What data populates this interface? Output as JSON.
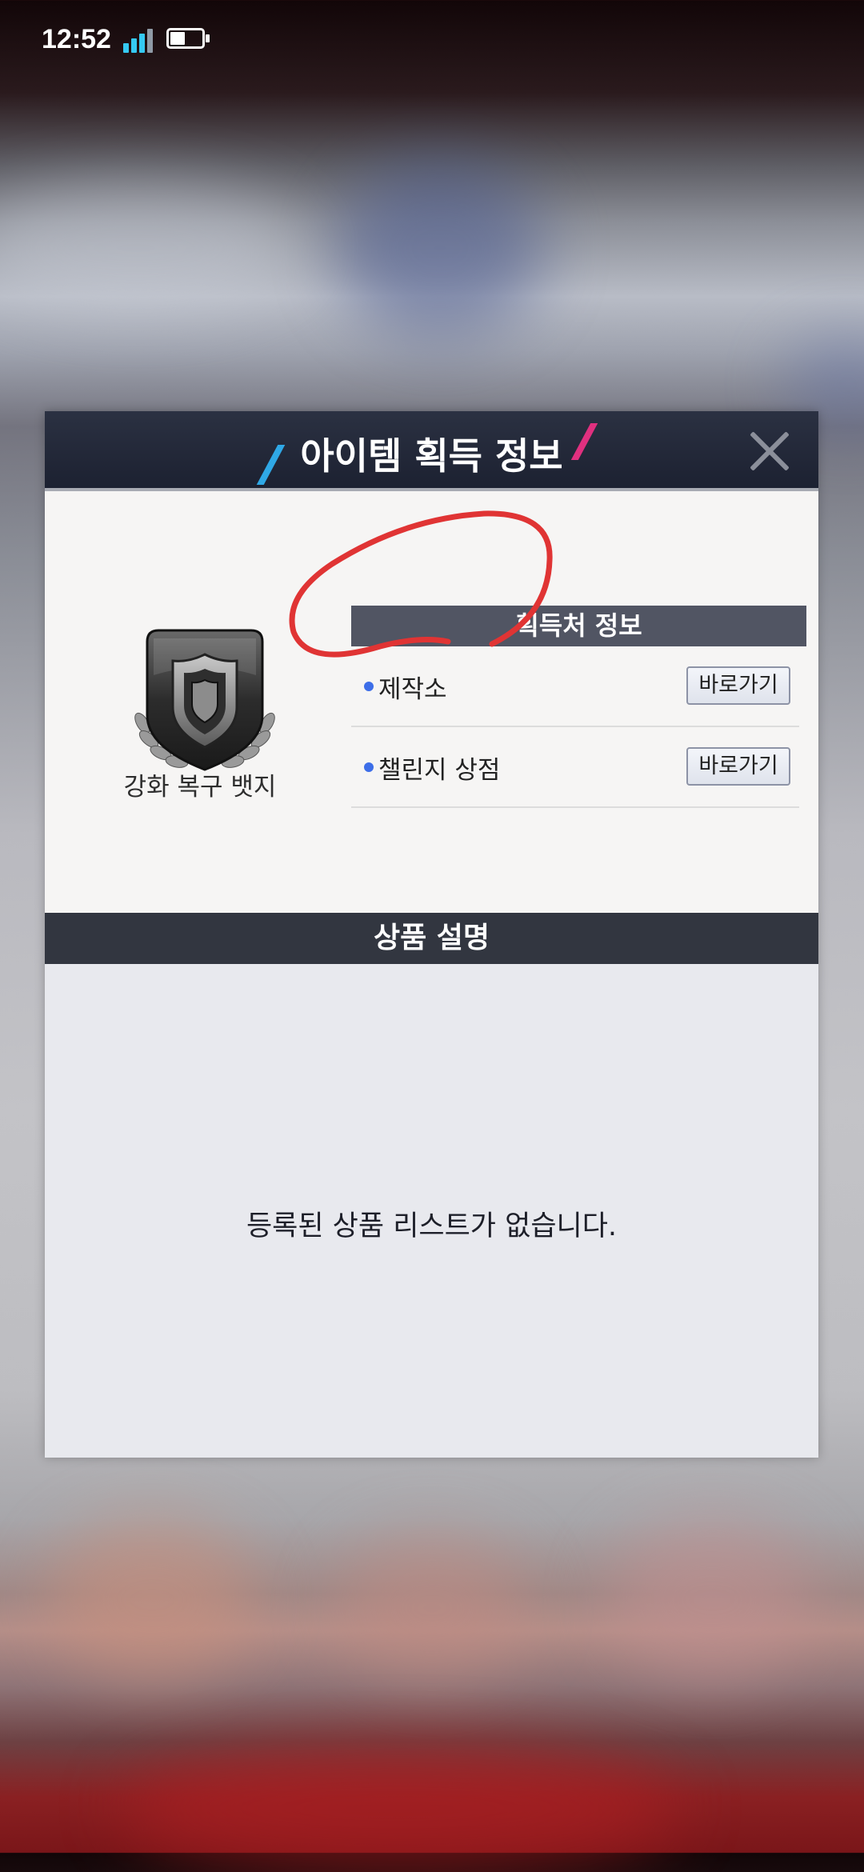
{
  "status_bar": {
    "time": "12:52"
  },
  "dialog": {
    "title": "아이템 획득 정보",
    "item": {
      "name": "강화 복구 뱃지"
    },
    "sources": {
      "header": "획득처 정보",
      "rows": [
        {
          "label": "제작소",
          "button": "바로가기"
        },
        {
          "label": "챌린지 상점",
          "button": "바로가기"
        }
      ]
    },
    "description": {
      "header": "상품 설명",
      "empty_message": "등록된 상품 리스트가 없습니다."
    }
  },
  "colors": {
    "header_bg": "#1c2131",
    "accent_blue": "#2fa8e6",
    "accent_pink": "#e0307f",
    "annotation_red": "#e03434"
  },
  "icons": [
    "signal-icon",
    "battery-icon",
    "close-icon",
    "shield-badge-icon",
    "bullet-dot-icon"
  ]
}
